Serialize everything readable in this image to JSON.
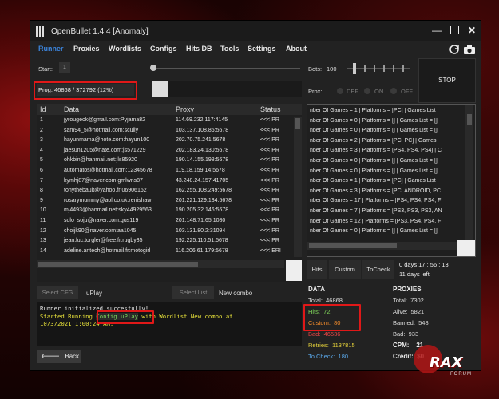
{
  "app": {
    "title": "OpenBullet 1.4.4 [Anomaly]"
  },
  "menu": [
    "Runner",
    "Proxies",
    "Wordlists",
    "Configs",
    "Hits DB",
    "Tools",
    "Settings",
    "About"
  ],
  "runner": {
    "start_label": "Start:",
    "start_value": "1",
    "bots_label": "Bots:",
    "bots_value": "100",
    "prox_label": "Prox:",
    "prox_options": [
      "DEF",
      "ON",
      "OFF"
    ],
    "stop_label": "STOP",
    "progress": "Prog: 46868 / 372792 (12%)"
  },
  "table": {
    "headers": [
      "Id",
      "Data",
      "Proxy",
      "Status"
    ],
    "rows": [
      {
        "id": "1",
        "data": "jyrougeck@gmail.com:Pyjama82",
        "proxy": "114.69.232.117:4145",
        "status": "<<< PR"
      },
      {
        "id": "2",
        "data": "sam94_5@hotmail.com:scully",
        "proxy": "103.137.108.86:5678",
        "status": "<<< PR"
      },
      {
        "id": "3",
        "data": "hayunmama@hote.com:hayun100",
        "proxy": "202.70.75.241:5678",
        "status": "<<< PR"
      },
      {
        "id": "4",
        "data": "jaesun1205@nate.com:js571229",
        "proxy": "202.183.24.130:5678",
        "status": "<<< PR"
      },
      {
        "id": "5",
        "data": "ohkbin@hanmail.net:jls85920",
        "proxy": "190.14.155.198:5678",
        "status": "<<< PR"
      },
      {
        "id": "6",
        "data": "automatos@hotmail.com:12345678",
        "proxy": "119.18.159.14:5678",
        "status": "<<< PR"
      },
      {
        "id": "7",
        "data": "kymhj87@naver.com:gmlwns87",
        "proxy": "43.248.24.157:41705",
        "status": "<<< PR"
      },
      {
        "id": "8",
        "data": "tonythebault@yahoo.fr:06906162",
        "proxy": "162.255.108.249:5678",
        "status": "<<< PR"
      },
      {
        "id": "9",
        "data": "rosarymummy@aol.co.uk:renishaw",
        "proxy": "201.221.129.134:5678",
        "status": "<<< PR"
      },
      {
        "id": "10",
        "data": "mj4493@hanmail.net:sky44929563",
        "proxy": "190.205.32.146:5678",
        "status": "<<< PR"
      },
      {
        "id": "11",
        "data": "solo_soju@naver.com:gus119",
        "proxy": "201.148.71.65:1080",
        "status": "<<< PR"
      },
      {
        "id": "12",
        "data": "choijk90@naver.com:aa1045",
        "proxy": "103.131.80.2:31094",
        "status": "<<< PR"
      },
      {
        "id": "13",
        "data": "jean.luc.torgler@free.fr:rugby35",
        "proxy": "192.225.110.51:5678",
        "status": "<<< PR"
      },
      {
        "id": "14",
        "data": "adeline.antech@hotmail.fr:motogirl",
        "proxy": "116.206.61.179:5678",
        "status": "<<< ERI"
      }
    ]
  },
  "captures": [
    "nber Of Games = 1 | Platforms = [PC] | Games List",
    "nber Of Games = 0 | Platforms = [] | Games List = []",
    "nber Of Games = 0 | Platforms = [] | Games List = []",
    "nber Of Games = 2 | Platforms = [PC, PC] | Games",
    "nber Of Games = 3 | Platforms = [PS4, PS4, PS4] | C",
    "nber Of Games = 0 | Platforms = [] | Games List = []",
    "nber Of Games = 0 | Platforms = [] | Games List = []",
    "nber Of Games = 1 | Platforms = [PC] | Games List",
    "nber Of Games = 3 | Platforms = [PC, ANDROID, PC",
    "nber Of Games = 17 | Platforms = [PS4, PS4, PS4, F",
    "nber Of Games = 7 | Platforms = [PS3, PS3, PS3, AN",
    "nber Of Games = 12 | Platforms = [PS3, PS4, PS4, F",
    "nber Of Games = 0 | Platforms = [] | Games List = []"
  ],
  "config": {
    "select_cfg": "Select CFG",
    "cfg_name": "uPlay",
    "select_list": "Select List",
    "list_name": "New combo"
  },
  "log": {
    "line1": "Runner initialized succesfully!",
    "line2a": "Started Running ",
    "line2b": "Config uPlay",
    "line2c": " with Wordlist New combo at",
    "line3": "10/3/2021 1:00:24 AM."
  },
  "back_label": "Back",
  "tabs": [
    "Hits",
    "Custom",
    "ToCheck"
  ],
  "timer": {
    "time": "0 days 17 : 56 : 13",
    "left": "11 days left"
  },
  "stats": {
    "data_header": "DATA",
    "total": "Total:",
    "total_v": "46868",
    "hits": "Hits:",
    "hits_v": "72",
    "custom": "Custom:",
    "custom_v": "80",
    "bad": "Bad:",
    "bad_v": "46536",
    "retries": "Retries:",
    "retries_v": "1137815",
    "tocheck": "To Check:",
    "tocheck_v": "180",
    "proxies_header": "PROXIES",
    "ptotal": "Total:",
    "ptotal_v": "7302",
    "alive": "Alive:",
    "alive_v": "5821",
    "banned": "Banned:",
    "banned_v": "548",
    "pbad": "Bad:",
    "pbad_v": "933",
    "cpm": "CPM:",
    "cpm_v": "21",
    "credit": "Credit:",
    "credit_v": "$0"
  },
  "watermark": {
    "brand": "RAX",
    "sub": "FORUM"
  },
  "colors": {
    "accent": "#3b82d8",
    "highlight": "#e01818",
    "hits": "#7fd65a",
    "custom": "#f08a2b",
    "bad": "#e84545",
    "retries": "#e6d23a",
    "tocheck": "#5aa7e8"
  }
}
